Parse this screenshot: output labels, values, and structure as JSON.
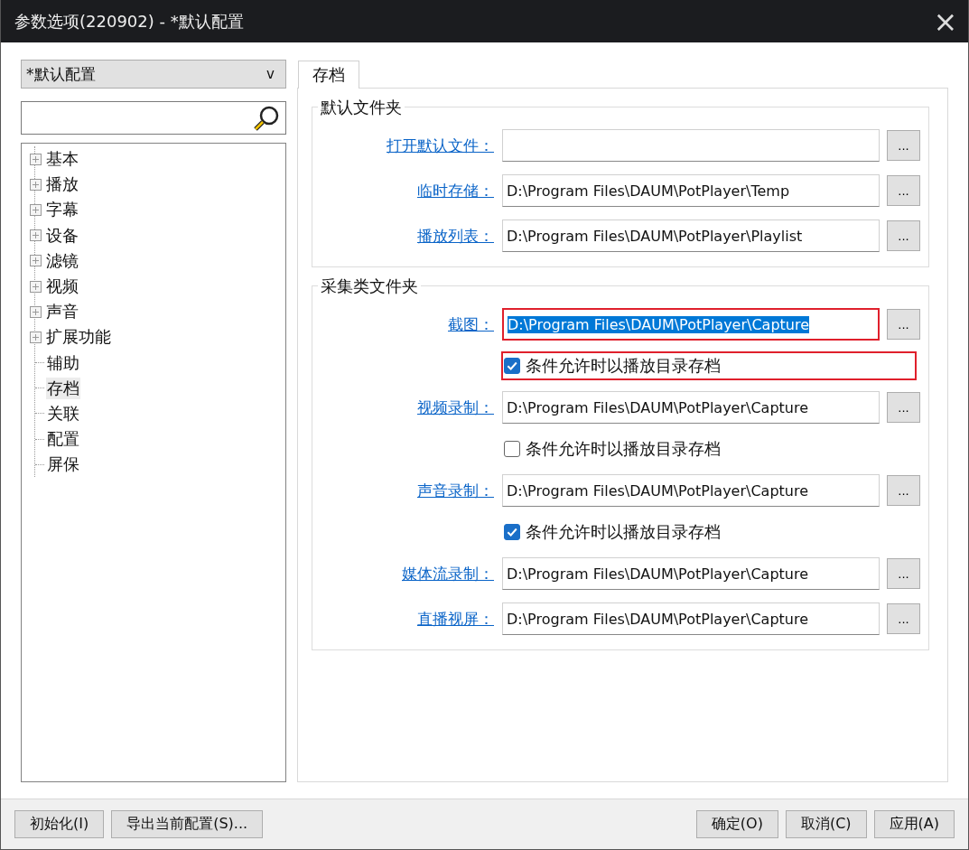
{
  "window": {
    "title": "参数选项(220902) - *默认配置",
    "close": "×"
  },
  "profile_select": {
    "value": "*默认配置",
    "arrow": "v"
  },
  "tree": {
    "items": [
      {
        "label": "基本",
        "kind": "folder",
        "selected": false
      },
      {
        "label": "播放",
        "kind": "folder",
        "selected": false
      },
      {
        "label": "字幕",
        "kind": "folder",
        "selected": false
      },
      {
        "label": "设备",
        "kind": "folder",
        "selected": false
      },
      {
        "label": "滤镜",
        "kind": "folder",
        "selected": false
      },
      {
        "label": "视频",
        "kind": "folder",
        "selected": false
      },
      {
        "label": "声音",
        "kind": "folder",
        "selected": false
      },
      {
        "label": "扩展功能",
        "kind": "folder",
        "selected": false
      },
      {
        "label": "辅助",
        "kind": "leaf",
        "selected": false
      },
      {
        "label": "存档",
        "kind": "leaf",
        "selected": true
      },
      {
        "label": "关联",
        "kind": "leaf",
        "selected": false
      },
      {
        "label": "配置",
        "kind": "leaf",
        "selected": false
      },
      {
        "label": "屏保",
        "kind": "leaf",
        "selected": false
      }
    ]
  },
  "tabs": [
    {
      "label": "存档",
      "selected": true
    }
  ],
  "groups": [
    {
      "title": "默认文件夹",
      "rows": [
        {
          "kind": "path",
          "label": "打开默认文件：",
          "browse": "...",
          "highlighted": false
        },
        {
          "kind": "path",
          "label": "临时存储：",
          "value": "D:\\Program Files\\DAUM\\PotPlayer\\Temp",
          "browse": "...",
          "highlighted": false
        },
        {
          "kind": "path",
          "label": "播放列表：",
          "value": "D:\\Program Files\\DAUM\\PotPlayer\\Playlist",
          "browse": "...",
          "highlighted": false
        }
      ]
    },
    {
      "title": "采集类文件夹",
      "rows": [
        {
          "kind": "path",
          "label": "截图：",
          "value": "D:\\Program Files\\DAUM\\PotPlayer\\Capture",
          "browse": "...",
          "highlighted": true,
          "text_selected": true
        },
        {
          "kind": "checkbox",
          "label": "条件允许时以播放目录存档",
          "checked": true,
          "highlighted": true
        },
        {
          "kind": "path",
          "label": "视频录制：",
          "value": "D:\\Program Files\\DAUM\\PotPlayer\\Capture",
          "browse": "...",
          "highlighted": false
        },
        {
          "kind": "checkbox",
          "label": "条件允许时以播放目录存档",
          "checked": false,
          "highlighted": false
        },
        {
          "kind": "path",
          "label": "声音录制：",
          "value": "D:\\Program Files\\DAUM\\PotPlayer\\Capture",
          "browse": "...",
          "highlighted": false
        },
        {
          "kind": "checkbox",
          "label": "条件允许时以播放目录存档",
          "checked": true,
          "highlighted": false
        },
        {
          "kind": "path",
          "label": "媒体流录制：",
          "value": "D:\\Program Files\\DAUM\\PotPlayer\\Capture",
          "browse": "...",
          "highlighted": false
        },
        {
          "kind": "path",
          "label": "直播视屏：",
          "value": "D:\\Program Files\\DAUM\\PotPlayer\\Capture",
          "browse": "...",
          "highlighted": false
        }
      ]
    }
  ],
  "buttons_left": [
    "初始化(I)",
    "导出当前配置(S)..."
  ],
  "buttons_right": [
    "确定(O)",
    "取消(C)",
    "应用(A)"
  ]
}
